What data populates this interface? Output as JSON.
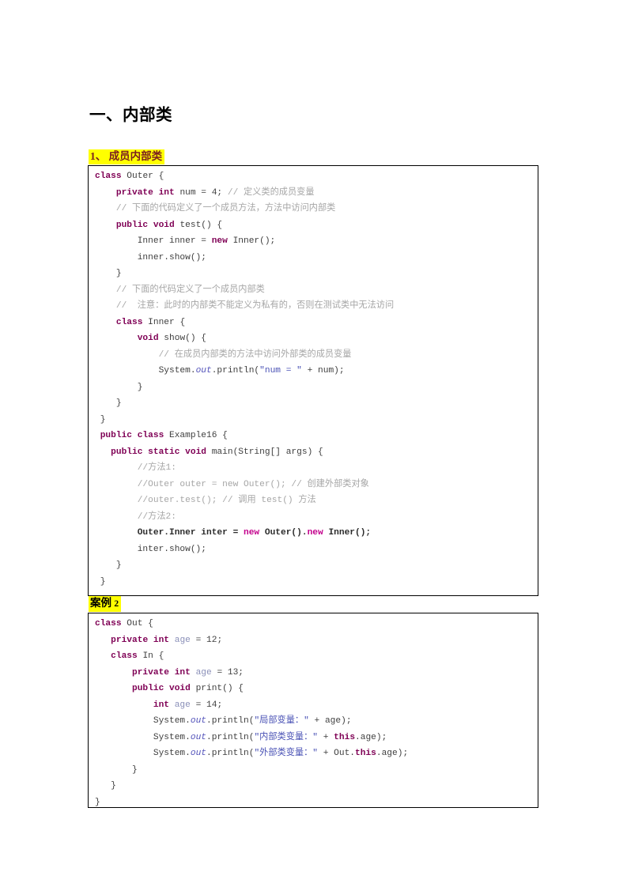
{
  "document": {
    "title": "一、内部类",
    "section_heading": "1、 成员内部类",
    "case_heading_text": "案例",
    "case_heading_num": "2"
  },
  "code_block_1": {
    "language": "java",
    "lines": [
      [
        {
          "t": "class ",
          "c": "kw"
        },
        {
          "t": "Outer {",
          "c": "pln"
        }
      ],
      [
        {
          "t": "    ",
          "c": "pln"
        },
        {
          "t": "private int ",
          "c": "kw"
        },
        {
          "t": "num = 4; ",
          "c": "pln"
        },
        {
          "t": "// 定义类的成员变量",
          "c": "cmt"
        }
      ],
      [
        {
          "t": "    ",
          "c": "pln"
        },
        {
          "t": "// 下面的代码定义了一个成员方法，方法中访问内部类",
          "c": "cmt"
        }
      ],
      [
        {
          "t": "    ",
          "c": "pln"
        },
        {
          "t": "public void ",
          "c": "kw"
        },
        {
          "t": "test() {",
          "c": "pln"
        }
      ],
      [
        {
          "t": "        Inner inner = ",
          "c": "pln"
        },
        {
          "t": "new ",
          "c": "kw"
        },
        {
          "t": "Inner();",
          "c": "pln"
        }
      ],
      [
        {
          "t": "        inner.show();",
          "c": "pln"
        }
      ],
      [
        {
          "t": "    }",
          "c": "pln"
        }
      ],
      [
        {
          "t": "    ",
          "c": "pln"
        },
        {
          "t": "// 下面的代码定义了一个成员内部类",
          "c": "cmt"
        }
      ],
      [
        {
          "t": "    ",
          "c": "pln"
        },
        {
          "t": "//  注意：此时的内部类不能定义为私有的，否则在测试类中无法访问",
          "c": "cmt"
        }
      ],
      [
        {
          "t": "    ",
          "c": "pln"
        },
        {
          "t": "class ",
          "c": "kw"
        },
        {
          "t": "Inner {",
          "c": "pln"
        }
      ],
      [
        {
          "t": "        ",
          "c": "pln"
        },
        {
          "t": "void ",
          "c": "kw"
        },
        {
          "t": "show() {",
          "c": "pln"
        }
      ],
      [
        {
          "t": "            ",
          "c": "pln"
        },
        {
          "t": "// 在成员内部类的方法中访问外部类的成员变量",
          "c": "cmt"
        }
      ],
      [
        {
          "t": "            System.",
          "c": "pln"
        },
        {
          "t": "out",
          "c": "stat"
        },
        {
          "t": ".println(",
          "c": "pln"
        },
        {
          "t": "\"num = \"",
          "c": "str"
        },
        {
          "t": " + num);",
          "c": "pln"
        }
      ],
      [
        {
          "t": "        }",
          "c": "pln"
        }
      ],
      [
        {
          "t": "    }",
          "c": "pln"
        }
      ],
      [
        {
          "t": " }",
          "c": "pln"
        }
      ],
      [
        {
          "t": " ",
          "c": "pln"
        },
        {
          "t": "public class ",
          "c": "kw"
        },
        {
          "t": "Example16 {",
          "c": "pln"
        }
      ],
      [
        {
          "t": "   ",
          "c": "pln"
        },
        {
          "t": "public static void ",
          "c": "kw"
        },
        {
          "t": "main(String[] args) {",
          "c": "pln"
        }
      ],
      [
        {
          "t": "        ",
          "c": "pln"
        },
        {
          "t": "//方法1:",
          "c": "cmt"
        }
      ],
      [
        {
          "t": "        ",
          "c": "pln"
        },
        {
          "t": "//Outer outer = new Outer(); // 创建外部类对象",
          "c": "cmt"
        }
      ],
      [
        {
          "t": "        ",
          "c": "pln"
        },
        {
          "t": "//outer.test(); // 调用 test() 方法",
          "c": "cmt"
        }
      ],
      [
        {
          "t": "        ",
          "c": "pln"
        },
        {
          "t": "//方法2:",
          "c": "cmt"
        }
      ],
      [
        {
          "t": "        ",
          "c": "pln"
        },
        {
          "t": "Outer.Inner inter = ",
          "c": "bold"
        },
        {
          "t": "new ",
          "c": "new"
        },
        {
          "t": "Outer().",
          "c": "bold"
        },
        {
          "t": "new ",
          "c": "new"
        },
        {
          "t": "Inner();",
          "c": "bold"
        }
      ],
      [
        {
          "t": "        inter.show();",
          "c": "pln"
        }
      ],
      [
        {
          "t": "    }",
          "c": "pln"
        }
      ],
      [
        {
          "t": " }",
          "c": "pln"
        }
      ]
    ]
  },
  "code_block_2": {
    "language": "java",
    "lines": [
      [
        {
          "t": "class ",
          "c": "kw"
        },
        {
          "t": "Out {",
          "c": "pln"
        }
      ],
      [
        {
          "t": "   ",
          "c": "pln"
        },
        {
          "t": "private int ",
          "c": "kw"
        },
        {
          "t": "age",
          "c": "fld"
        },
        {
          "t": " = 12;",
          "c": "pln"
        }
      ],
      [
        {
          "t": "   ",
          "c": "pln"
        },
        {
          "t": "class ",
          "c": "kw"
        },
        {
          "t": "In {",
          "c": "pln"
        }
      ],
      [
        {
          "t": "       ",
          "c": "pln"
        },
        {
          "t": "private int ",
          "c": "kw"
        },
        {
          "t": "age",
          "c": "fld"
        },
        {
          "t": " = 13;",
          "c": "pln"
        }
      ],
      [
        {
          "t": "       ",
          "c": "pln"
        },
        {
          "t": "public void ",
          "c": "kw"
        },
        {
          "t": "print() {",
          "c": "pln"
        }
      ],
      [
        {
          "t": "           ",
          "c": "pln"
        },
        {
          "t": "int ",
          "c": "kw"
        },
        {
          "t": "age",
          "c": "fld"
        },
        {
          "t": " = 14;",
          "c": "pln"
        }
      ],
      [
        {
          "t": "           System.",
          "c": "pln"
        },
        {
          "t": "out",
          "c": "stat"
        },
        {
          "t": ".println(",
          "c": "pln"
        },
        {
          "t": "\"局部变量：\"",
          "c": "str"
        },
        {
          "t": " + age);",
          "c": "pln"
        }
      ],
      [
        {
          "t": "           System.",
          "c": "pln"
        },
        {
          "t": "out",
          "c": "stat"
        },
        {
          "t": ".println(",
          "c": "pln"
        },
        {
          "t": "\"内部类变量：\"",
          "c": "str"
        },
        {
          "t": " + ",
          "c": "pln"
        },
        {
          "t": "this",
          "c": "kw"
        },
        {
          "t": ".age);",
          "c": "pln"
        }
      ],
      [
        {
          "t": "           System.",
          "c": "pln"
        },
        {
          "t": "out",
          "c": "stat"
        },
        {
          "t": ".println(",
          "c": "pln"
        },
        {
          "t": "\"外部类变量：\"",
          "c": "str"
        },
        {
          "t": " + Out.",
          "c": "pln"
        },
        {
          "t": "this",
          "c": "kw"
        },
        {
          "t": ".age);",
          "c": "pln"
        }
      ],
      [
        {
          "t": "       }",
          "c": "pln"
        }
      ],
      [
        {
          "t": "   }",
          "c": "pln"
        }
      ],
      [
        {
          "t": "}",
          "c": "pln"
        }
      ]
    ]
  },
  "colors": {
    "keyword": "#7f0055",
    "new_keyword": "#c3008c",
    "comment": "#a6a6a6",
    "string": "#4a52b5",
    "field": "#8a8fb8",
    "static_member": "#5555bb",
    "plain": "#3f3f3f",
    "highlight": "#ffff00",
    "section_heading": "#7b2020",
    "border": "#000000"
  }
}
